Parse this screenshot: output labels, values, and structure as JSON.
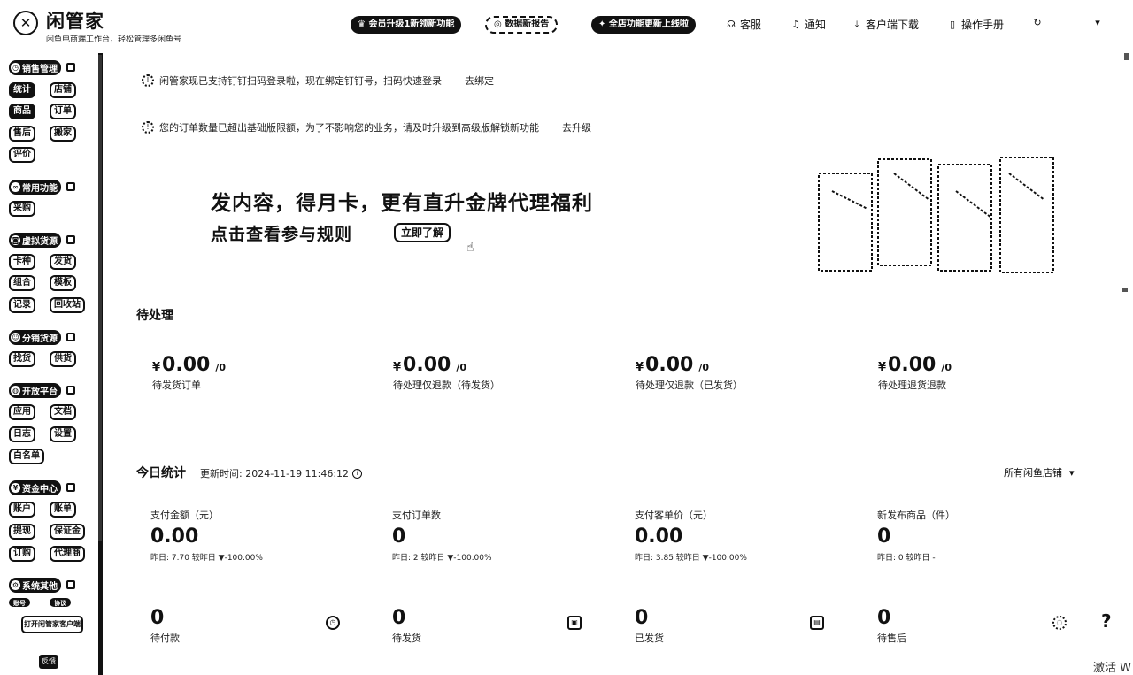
{
  "header": {
    "logo_char": "✕",
    "title": "闲管家",
    "subtitle": "闲鱼电商端工作台，轻松管理多闲鱼号",
    "pills": [
      "会员升级1新领新功能",
      "数据新报告",
      "全店功能更新上线啦"
    ],
    "links": [
      {
        "icon": "headset-icon",
        "label": "客服"
      },
      {
        "icon": "bell-icon",
        "label": "通知"
      },
      {
        "icon": "download-icon",
        "label": "客户端下载"
      },
      {
        "icon": "book-icon",
        "label": "操作手册"
      }
    ],
    "refresh_icon": "refresh-icon",
    "dropdown_icon": "caret-down-icon"
  },
  "sidebar": {
    "groups": [
      {
        "title": "销售管理",
        "items": [
          "统计",
          "店铺",
          "商品",
          "订单",
          "售后",
          "搬家",
          "评价"
        ]
      },
      {
        "title": "常用功能",
        "items": [
          "采购"
        ]
      },
      {
        "title": "虚拟货源",
        "items": [
          "卡种",
          "发货",
          "组合",
          "模板",
          "记录",
          "回收站"
        ]
      },
      {
        "title": "分销货源",
        "items": [
          "找货",
          "供货"
        ]
      },
      {
        "title": "开放平台",
        "items": [
          "应用",
          "文档",
          "日志",
          "设置",
          "白名单"
        ]
      },
      {
        "title": "资金中心",
        "items": [
          "账户",
          "账单",
          "提现",
          "保证金",
          "订购",
          "代理商"
        ]
      },
      {
        "title": "系统其他",
        "items": [
          "账号",
          "协议"
        ]
      }
    ],
    "open_client": "打开闲管家客户端",
    "bottom_chip": "反馈"
  },
  "notices": [
    {
      "text": "闲管家现已支持钉钉扫码登录啦，现在绑定钉钉号，扫码快速登录",
      "action": "去绑定"
    },
    {
      "text": "您的订单数量已超出基础版限额，为了不影响您的业务，请及时升级到高级版解锁新功能",
      "action": "去升级"
    }
  ],
  "banner": {
    "line1": "发内容，得月卡，更有直升金牌代理福利",
    "line2": "点击查看参与规则",
    "button": "立即了解"
  },
  "pending": {
    "title": "待处理",
    "items": [
      {
        "currency": "¥",
        "amount": "0.00",
        "count": "/0",
        "label": "待发货订单"
      },
      {
        "currency": "¥",
        "amount": "0.00",
        "count": "/0",
        "label": "待处理仅退款（待发货）"
      },
      {
        "currency": "¥",
        "amount": "0.00",
        "count": "/0",
        "label": "待处理仅退款（已发货）"
      },
      {
        "currency": "¥",
        "amount": "0.00",
        "count": "/0",
        "label": "待处理退货退款"
      }
    ]
  },
  "today": {
    "title": "今日统计",
    "updated_label": "更新时间: 2024-11-19 11:46:12",
    "store_filter": "所有闲鱼店铺",
    "stats": [
      {
        "label": "支付金额（元）",
        "value": "0.00",
        "compare": "昨日: 7.70   较昨日 ▼-100.00%"
      },
      {
        "label": "支付订单数",
        "value": "0",
        "compare": "昨日: 2   较昨日 ▼-100.00%"
      },
      {
        "label": "支付客单价（元）",
        "value": "0.00",
        "compare": "昨日: 3.85   较昨日 ▼-100.00%"
      },
      {
        "label": "新发布商品（件）",
        "value": "0",
        "compare": "昨日: 0   较昨日 -"
      }
    ],
    "counts": [
      {
        "value": "0",
        "label": "待付款",
        "icon": "clock-icon"
      },
      {
        "value": "0",
        "label": "待发货",
        "icon": "truck-icon"
      },
      {
        "value": "0",
        "label": "已发货",
        "icon": "package-icon"
      },
      {
        "value": "0",
        "label": "待售后",
        "icon": "service-icon"
      }
    ]
  },
  "help_label": "?",
  "watermark": "激活 W"
}
